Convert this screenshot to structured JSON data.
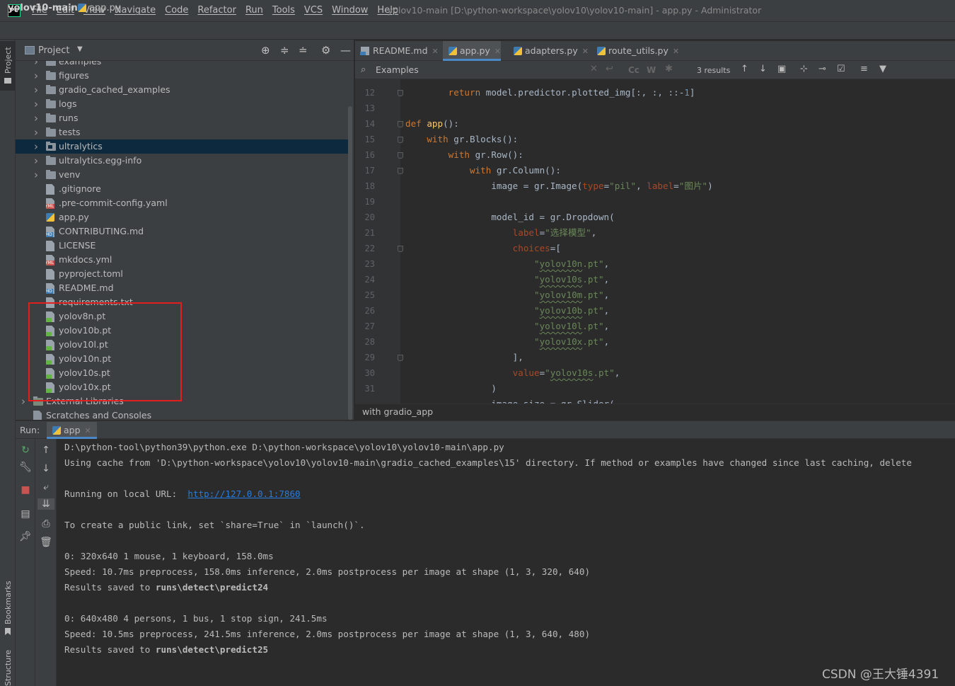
{
  "menu": [
    "File",
    "Edit",
    "View",
    "Navigate",
    "Code",
    "Refactor",
    "Run",
    "Tools",
    "VCS",
    "Window",
    "Help"
  ],
  "window_title": "yolov10-main [D:\\python-workspace\\yolov10\\yolov10-main] - app.py - Administrator",
  "app_logo": "PC",
  "navbar": {
    "root": "yolov10-main",
    "file": "app.py"
  },
  "left_strip": {
    "project": "Project",
    "bookmarks": "Bookmarks",
    "structure": "Structure"
  },
  "project_panel": {
    "title": "Project",
    "tree": [
      {
        "label": "examples",
        "kind": "folder",
        "indent": 0
      },
      {
        "label": "figures",
        "kind": "folder",
        "indent": 0
      },
      {
        "label": "gradio_cached_examples",
        "kind": "folder",
        "indent": 0
      },
      {
        "label": "logs",
        "kind": "folder",
        "indent": 0
      },
      {
        "label": "runs",
        "kind": "folder",
        "indent": 0
      },
      {
        "label": "tests",
        "kind": "folder",
        "indent": 0
      },
      {
        "label": "ultralytics",
        "kind": "package",
        "indent": 0,
        "selected": true
      },
      {
        "label": "ultralytics.egg-info",
        "kind": "folder",
        "indent": 0
      },
      {
        "label": "venv",
        "kind": "folder",
        "indent": 0
      },
      {
        "label": ".gitignore",
        "kind": "doc",
        "indent": 0
      },
      {
        "label": ".pre-commit-config.yaml",
        "kind": "yml",
        "indent": 0
      },
      {
        "label": "app.py",
        "kind": "py",
        "indent": 0
      },
      {
        "label": "CONTRIBUTING.md",
        "kind": "md",
        "indent": 0
      },
      {
        "label": "LICENSE",
        "kind": "doc",
        "indent": 0
      },
      {
        "label": "mkdocs.yml",
        "kind": "yml",
        "indent": 0
      },
      {
        "label": "pyproject.toml",
        "kind": "doc",
        "indent": 0
      },
      {
        "label": "README.md",
        "kind": "md",
        "indent": 0
      },
      {
        "label": "requirements.txt",
        "kind": "doc",
        "indent": 0
      },
      {
        "label": "yolov8n.pt",
        "kind": "pt",
        "indent": 0
      },
      {
        "label": "yolov10b.pt",
        "kind": "pt",
        "indent": 0
      },
      {
        "label": "yolov10l.pt",
        "kind": "pt",
        "indent": 0
      },
      {
        "label": "yolov10n.pt",
        "kind": "pt",
        "indent": 0
      },
      {
        "label": "yolov10s.pt",
        "kind": "pt",
        "indent": 0
      },
      {
        "label": "yolov10x.pt",
        "kind": "pt",
        "indent": 0
      },
      {
        "label": "External Libraries",
        "kind": "lib",
        "indent": -1
      },
      {
        "label": "Scratches and Consoles",
        "kind": "scratch",
        "indent": -1
      }
    ]
  },
  "editor_tabs": [
    {
      "label": "README.md",
      "icon": "md-icon",
      "active": false
    },
    {
      "label": "app.py",
      "icon": "python-icon",
      "active": true
    },
    {
      "label": "adapters.py",
      "icon": "python-icon",
      "active": false
    },
    {
      "label": "route_utils.py",
      "icon": "python-icon",
      "active": false
    }
  ],
  "search": {
    "query": "Examples",
    "results": "3 results",
    "match_case": "Cc",
    "words": "W"
  },
  "code_lines": [
    {
      "n": "12",
      "html": "        <span class='kw'>return</span> model.predictor.plotted_img[:, :, ::-<span class='num'>1</span>]",
      "fold": true
    },
    {
      "n": "13",
      "html": "",
      "fold": false
    },
    {
      "n": "14",
      "html": "<span class='kw'>def</span> <span class='fn'>app</span>():",
      "fold": true
    },
    {
      "n": "15",
      "html": "    <span class='kw'>with</span> gr.Blocks():",
      "fold": true
    },
    {
      "n": "16",
      "html": "        <span class='kw'>with</span> gr.Row():",
      "fold": true
    },
    {
      "n": "17",
      "html": "            <span class='kw'>with</span> gr.Column():",
      "fold": true
    },
    {
      "n": "18",
      "html": "                image = gr.Image(<span class='prm'>type</span>=<span class='str'>\"pil\"</span>, <span class='prm'>label</span>=<span class='str'>\"图片\"</span>)",
      "fold": false
    },
    {
      "n": "19",
      "html": "",
      "fold": false
    },
    {
      "n": "20",
      "html": "                model_id = gr.Dropdown(",
      "fold": false
    },
    {
      "n": "21",
      "html": "                    <span class='prm'>label</span>=<span class='str'>\"选择模型\"</span>,",
      "fold": false
    },
    {
      "n": "22",
      "html": "                    <span class='prm'>choices</span>=[",
      "fold": true
    },
    {
      "n": "23",
      "html": "                        <span class='str'>\"<span class='uw'>yolov10n</span>.pt\"</span>,",
      "fold": false
    },
    {
      "n": "24",
      "html": "                        <span class='str'>\"<span class='uw'>yolov10s</span>.pt\"</span>,",
      "fold": false
    },
    {
      "n": "25",
      "html": "                        <span class='str'>\"<span class='uw'>yolov10m</span>.pt\"</span>,",
      "fold": false
    },
    {
      "n": "26",
      "html": "                        <span class='str'>\"<span class='uw'>yolov10b</span>.pt\"</span>,",
      "fold": false
    },
    {
      "n": "27",
      "html": "                        <span class='str'>\"<span class='uw'>yolov10l</span>.pt\"</span>,",
      "fold": false
    },
    {
      "n": "28",
      "html": "                        <span class='str'>\"<span class='uw'>yolov10x</span>.pt\"</span>,",
      "fold": false
    },
    {
      "n": "29",
      "html": "                    ],",
      "fold": true
    },
    {
      "n": "30",
      "html": "                    <span class='prm'>value</span>=<span class='str'>\"<span class='uw'>yolov10s</span>.pt\"</span>,",
      "fold": false
    },
    {
      "n": "31",
      "html": "                )",
      "fold": false
    },
    {
      "n": "",
      "html": "                image_size = gr.Slider(",
      "fold": false
    }
  ],
  "breadcrumb": "with gradio_app",
  "run_panel": {
    "label": "Run:",
    "tab": "app"
  },
  "console_lines": [
    "D:\\python-tool\\python39\\python.exe D:\\python-workspace\\yolov10\\yolov10-main\\app.py",
    "Using cache from 'D:\\python-workspace\\yolov10\\yolov10-main\\gradio_cached_examples\\15' directory. If method or examples have changed since last caching, delete",
    "",
    "",
    "",
    "To create a public link, set `share=True` in `launch()`.",
    "",
    "0: 320x640 1 mouse, 1 keyboard, 158.0ms",
    "Speed: 10.7ms preprocess, 158.0ms inference, 2.0ms postprocess per image at shape (1, 3, 320, 640)",
    "",
    "",
    "0: 640x480 4 persons, 1 bus, 1 stop sign, 241.5ms",
    "Speed: 10.5ms preprocess, 241.5ms inference, 2.0ms postprocess per image at shape (1, 3, 640, 480)",
    ""
  ],
  "console_url_line": {
    "prefix": "Running on local URL:  ",
    "url": "http://127.0.0.1:7860"
  },
  "console_saved_1": {
    "prefix": "Results saved to ",
    "path": "runs\\detect\\predict24"
  },
  "console_saved_2": {
    "prefix": "Results saved to ",
    "path": "runs\\detect\\predict25"
  },
  "watermark": "CSDN @王大锤4391"
}
